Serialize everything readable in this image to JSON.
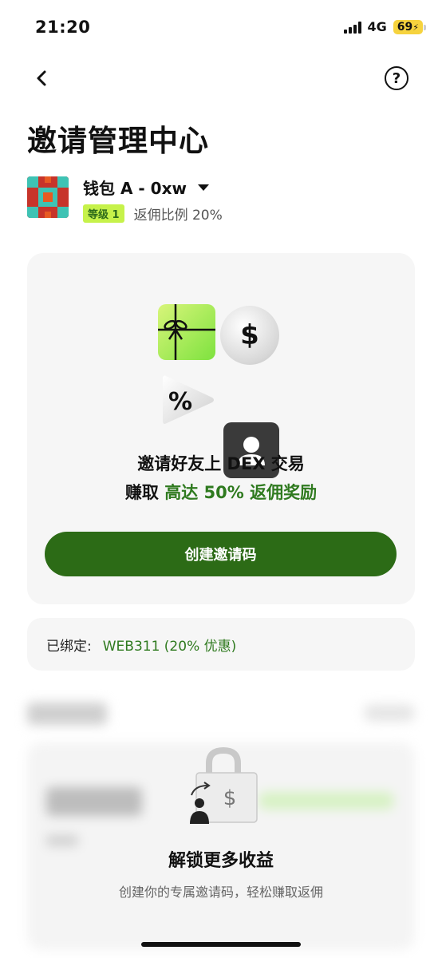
{
  "status_bar": {
    "time": "21:20",
    "network": "4G",
    "battery": "69"
  },
  "nav": {
    "back_icon": "chevron-left-icon",
    "help_icon": "question-circle-icon",
    "help_glyph": "?"
  },
  "page": {
    "title": "邀请管理中心"
  },
  "wallet": {
    "name": "钱包 A - 0xw",
    "level": "等级 1",
    "rebate": "返佣比例 20%"
  },
  "hero": {
    "line1": "邀请好友上 DEX 交易",
    "line2_prefix": "赚取 ",
    "line2_accent": "高达 50% 返佣奖励",
    "icon_dollar": "$",
    "icon_percent": "%",
    "create_button": "创建邀请码"
  },
  "bound": {
    "label": "已绑定:",
    "value": "WEB311 (20% 优惠)"
  },
  "locked": {
    "title": "解锁更多收益",
    "description": "创建你的专属邀请码，轻松赚取返佣",
    "icon_dollar": "$"
  },
  "colors": {
    "accent_green": "#2c6b16",
    "badge_lime": "#c6f24a",
    "text_green": "#2f7a1f",
    "battery_yellow": "#f6d33e"
  }
}
